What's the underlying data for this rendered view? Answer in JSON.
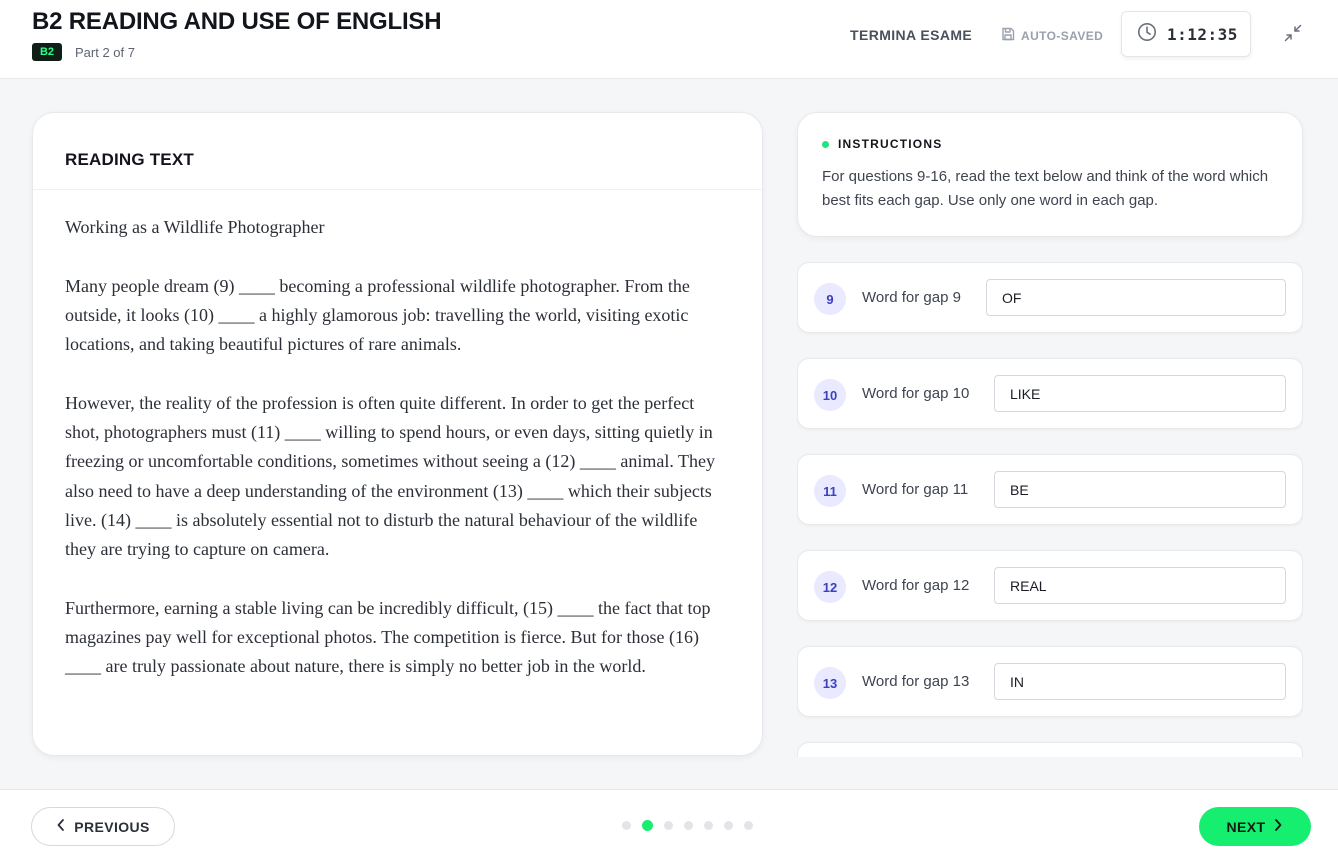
{
  "header": {
    "title": "B2 READING AND USE OF ENGLISH",
    "level_badge": "B2",
    "part": "Part 2 of 7",
    "end_exam_label": "TERMINA ESAME",
    "autosaved_label": "AUTO-SAVED",
    "timer": "1:12:35"
  },
  "reading": {
    "heading": "READING TEXT",
    "title": "Working as a Wildlife Photographer",
    "paragraphs": [
      "Many people dream (9) ____ becoming a professional wildlife photographer. From the outside, it looks (10) ____ a highly glamorous job: travelling the world, visiting exotic locations, and taking beautiful pictures of rare animals.",
      "However, the reality of the profession is often quite different. In order to get the perfect shot, photographers must (11) ____ willing to spend hours, or even days, sitting quietly in freezing or uncomfortable conditions, sometimes without seeing a (12) ____ animal. They also need to have a deep understanding of the environment (13) ____ which their subjects live. (14) ____ is absolutely essential not to disturb the natural behaviour of the wildlife they are trying to capture on camera.",
      "Furthermore, earning a stable living can be incredibly difficult, (15) ____ the fact that top magazines pay well for exceptional photos. The competition is fierce. But for those (16) ____ are truly passionate about nature, there is simply no better job in the world."
    ]
  },
  "instructions": {
    "heading": "INSTRUCTIONS",
    "text": "For questions 9-16, read the text below and think of the word which best fits each gap. Use only one word in each gap."
  },
  "questions": [
    {
      "number": "9",
      "label": "Word for gap 9",
      "value": "OF"
    },
    {
      "number": "10",
      "label": "Word for gap 10",
      "value": "LIKE"
    },
    {
      "number": "11",
      "label": "Word for gap 11",
      "value": "BE"
    },
    {
      "number": "12",
      "label": "Word for gap 12",
      "value": "REAL"
    },
    {
      "number": "13",
      "label": "Word for gap 13",
      "value": "IN"
    }
  ],
  "footer": {
    "previous_label": "PREVIOUS",
    "next_label": "NEXT",
    "pages_total": 7,
    "current_page": 2
  },
  "colors": {
    "accent_green": "#16ee6f",
    "badge_bg": "#0f1f17",
    "question_badge_bg": "#e9eaff",
    "question_badge_text": "#3b3fc4"
  },
  "icons": {
    "autosaved": "floppy-disk-icon",
    "timer": "clock-icon",
    "collapse": "collapse-arrows-icon",
    "previous": "chevron-left-icon",
    "next": "chevron-right-icon"
  }
}
